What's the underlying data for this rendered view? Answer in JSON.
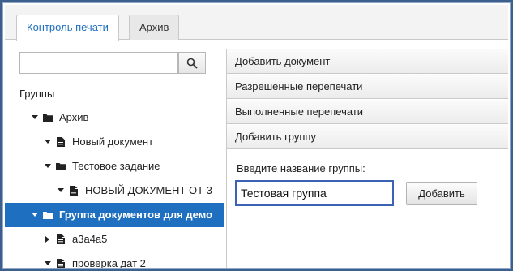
{
  "tabs": [
    {
      "label": "Контроль печати",
      "active": true
    },
    {
      "label": "Архив",
      "active": false
    }
  ],
  "search": {
    "value": "",
    "placeholder": ""
  },
  "groups_label": "Группы",
  "tree": [
    {
      "label": "Архив",
      "type": "folder",
      "level": 0,
      "expanded": true
    },
    {
      "label": "Новый документ",
      "type": "document",
      "level": 1,
      "expanded": true
    },
    {
      "label": "Тестовое задание",
      "type": "folder",
      "level": 1,
      "expanded": true
    },
    {
      "label": "НОВЫЙ ДОКУМЕНТ ОТ 3",
      "type": "document",
      "level": 2,
      "expanded": true
    },
    {
      "label": "Группа документов для демо",
      "type": "folder",
      "level": 0,
      "expanded": true,
      "selected": true
    },
    {
      "label": "a3a4a5",
      "type": "document",
      "level": 1,
      "expanded": false
    },
    {
      "label": "проверка дат 2",
      "type": "document",
      "level": 1,
      "expanded": true
    }
  ],
  "accordion": {
    "sections": [
      "Добавить документ",
      "Разрешенные перепечати",
      "Выполненные перепечати",
      "Добавить группу"
    ],
    "prompt": "Введите название группы:",
    "group_name_value": "Тестовая группа",
    "add_button": "Добавить"
  },
  "colors": {
    "accent": "#1f6fc1",
    "frame": "#3d5f8e",
    "input_focus": "#3b62b3"
  }
}
